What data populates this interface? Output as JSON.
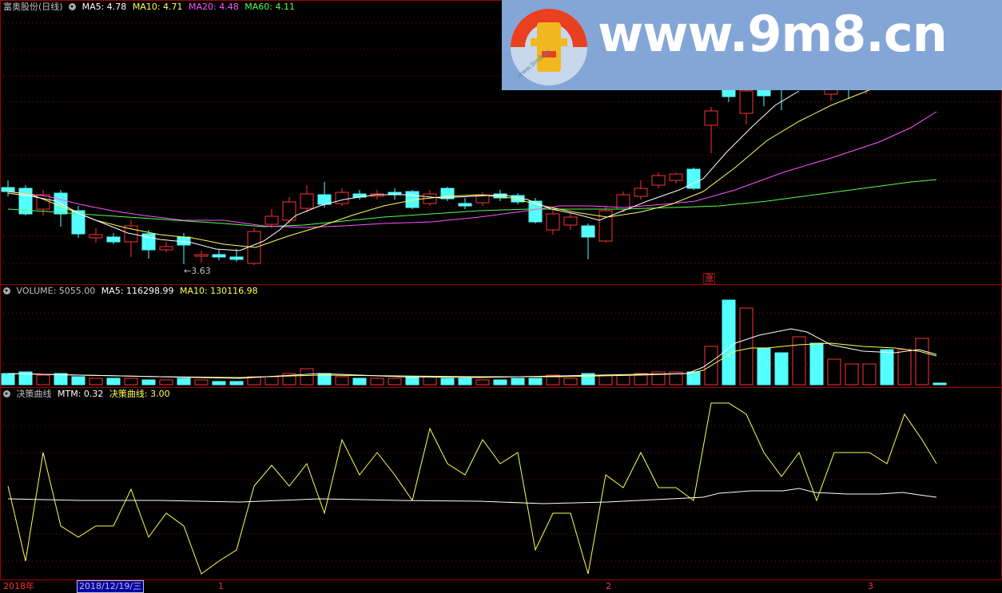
{
  "main_panel": {
    "stock_name": "富奥股份",
    "period": "(日线)",
    "ma5_label": "MA5: 4.78",
    "ma10_label": "MA10: 4.71",
    "ma20_label": "MA20: 4.48",
    "ma60_label": "MA60: 4.11",
    "low_marker": "3.63",
    "limit_up_marker": "涨"
  },
  "volume_panel": {
    "label": "VOLUME: 5055.00",
    "ma5_label": "MA5: 116298.99",
    "ma10_label": "MA10: 130116.98"
  },
  "indicator_panel": {
    "name": "决策曲线",
    "mtm_label": "MTM: 0.32",
    "curve_label": "决策曲线: 3.00"
  },
  "time_axis": {
    "year_label": "2018年",
    "cursor_date": "2018/12/19/三",
    "month_1": "1",
    "month_2": "2",
    "month_3": "3"
  },
  "watermark": {
    "text": "www.9m8.cn",
    "ring_text": "www.9m8.cn"
  },
  "colors": {
    "up": "#ff3232",
    "down": "#54ffff",
    "ma5": "#ffffff",
    "ma10": "#ffff54",
    "ma20": "#ff54ff",
    "ma60": "#54ff54",
    "mtm": "#ffffff",
    "curve": "#ffff54",
    "grid": "#a00000"
  },
  "icons": [
    "panel-menu-icon"
  ]
}
